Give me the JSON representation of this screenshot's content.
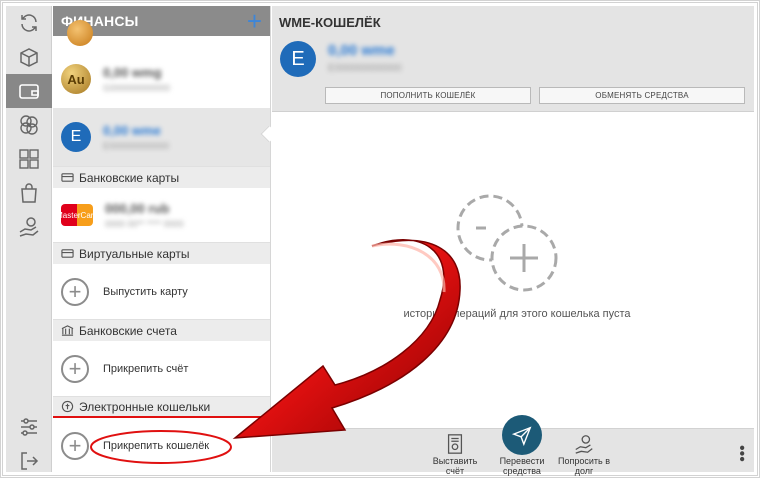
{
  "list": {
    "title": "ФИНАНСЫ",
    "add_symbol": "+",
    "wallets": [
      {
        "coin": "Au",
        "amount": "0,00 wmg",
        "sub": "G000000000000"
      },
      {
        "coin": "E",
        "amount": "0,00 wme",
        "sub": "E000000000000"
      }
    ],
    "sections": {
      "bank_cards": "Банковские карты",
      "virtual_cards": "Виртуальные карты",
      "bank_accounts": "Банковские счета",
      "e_wallets": "Электронные кошельки"
    },
    "card": {
      "logo": "MasterCard",
      "amount": "000,00 rub",
      "sub": "0000 00** **** 0000"
    },
    "actions": {
      "issue_card": "Выпустить карту",
      "attach_account": "Прикрепить счёт",
      "attach_wallet": "Прикрепить кошелёк"
    }
  },
  "main": {
    "title": "WME-КОШЕЛЁК",
    "coin": "E",
    "amount": "0,00 wme",
    "sub": "E000000000000",
    "top_up_label": "ПОПОЛНИТЬ КОШЕЛЁК",
    "exchange_label": "ОБМЕНЯТЬ СРЕДСТВА",
    "empty_text": "история операций для этого кошелька пуста"
  },
  "bottom": {
    "invoice": "Выставить\nсчёт",
    "transfer": "Перевести\nсредства",
    "borrow": "Попросить в\nдолг",
    "more": "•••"
  },
  "colors": {
    "accent_blue": "#1f6bb9",
    "header_gray": "#8b8b8b",
    "send_teal": "#1c5a77",
    "arrow_red": "#e01010"
  },
  "icons": {
    "rail": [
      "refresh-icon",
      "box-icon",
      "wallet-icon",
      "coins-icon",
      "phone-card-icon",
      "shopping-bag-icon",
      "hand-coin-icon",
      "settings-sliders-icon",
      "logout-icon"
    ]
  }
}
